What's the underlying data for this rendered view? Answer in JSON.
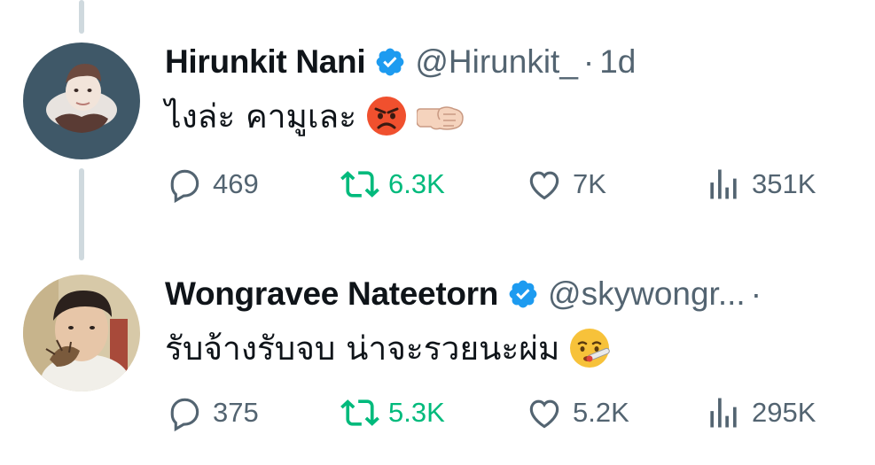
{
  "tweets": [
    {
      "name": "Hirunkit Nani",
      "handle": "@Hirunkit_",
      "separator": "·",
      "time": "1d",
      "text": "ไงล่ะ คามูเละ",
      "emojis": [
        "pouting-face",
        "left-facing-fist"
      ],
      "actions": {
        "replies": "469",
        "retweets": "6.3K",
        "likes": "7K",
        "views": "351K"
      }
    },
    {
      "name": "Wongravee Nateetorn",
      "handle": "@skywongr...",
      "separator": "·",
      "time": "",
      "text": "รับจ้างรับจบ น่าจะรวยนะผ่ม",
      "emojis": [
        "face-with-thermometer"
      ],
      "actions": {
        "replies": "375",
        "retweets": "5.3K",
        "likes": "5.2K",
        "views": "295K"
      }
    }
  ],
  "colors": {
    "text_primary": "#0f1419",
    "text_secondary": "#536471",
    "verified_blue": "#1d9bf0",
    "retweet_green": "#00ba7c",
    "thread_line": "#cfd9de"
  }
}
